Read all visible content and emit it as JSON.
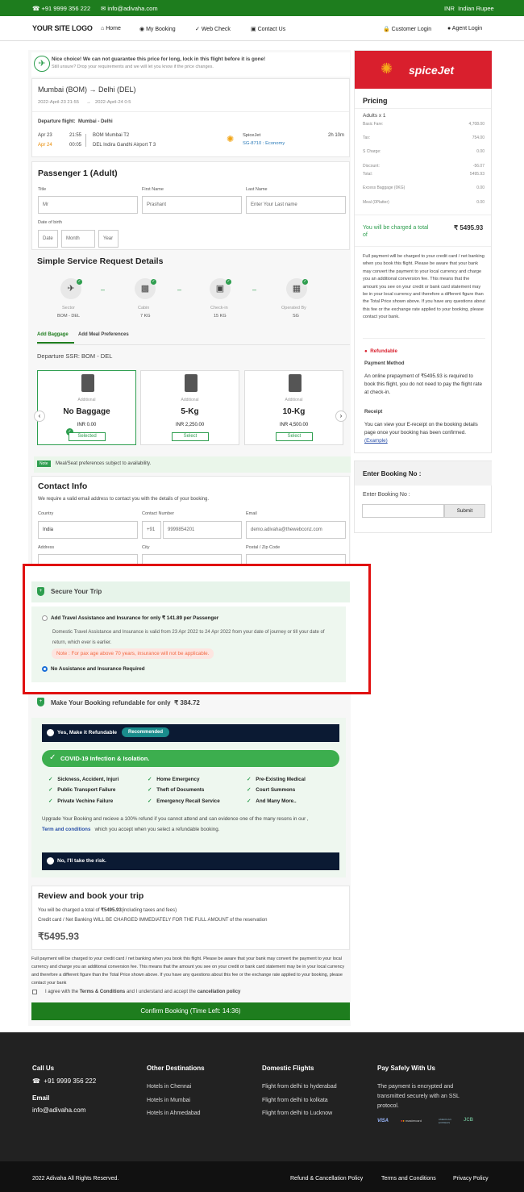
{
  "topbar": {
    "phone": "+91 9999 356 222",
    "email": "info@adivaha.com",
    "currency_code": "INR",
    "currency_name": "Indian Rupee"
  },
  "nav": {
    "logo": "YOUR SITE LOGO",
    "home": "Home",
    "my_booking": "My Booking",
    "web_check": "Web Check",
    "contact": "Contact Us",
    "customer_login": "Customer Login",
    "agent_login": "Agent Login"
  },
  "notice": {
    "title": "Nice choice! We can not guarantee this price for long, lock in this flight before it is gone!",
    "sub": "Still unsure? Drop your requirements and we will let you know if the price changes."
  },
  "flight": {
    "route": "Mumbai (BOM) → Delhi (DEL)",
    "dep_time": "2022-April-23 21:55",
    "arrow": "→",
    "arr_time": "2022-April-24 0:5",
    "dep_label": "Departure flight:",
    "dep_route": "Mumbai  -  Delhi",
    "dep_date": "Apr 23",
    "arr_date": "Apr 24",
    "dep_clock": "21:55",
    "arr_clock": "00:05",
    "dep_airport": "BOM Mumbai T2",
    "arr_airport": "DEL Indira Gandhi Airport T 3",
    "airline": "SpiceJet",
    "flight_no": "SG-8710 :",
    "cabin": "Economy",
    "duration": "2h 10m"
  },
  "passenger": {
    "heading": "Passenger 1 (Adult)",
    "title_label": "Title",
    "title_value": "Mr",
    "first_label": "First Name",
    "first_value": "Prashant",
    "last_label": "Last Name",
    "last_placeholder": "Enter Your Last name",
    "dob_label": "Date of birth",
    "date": "Date",
    "month": "Month",
    "year": "Year"
  },
  "service": {
    "heading": "Simple Service Request Details",
    "items": [
      {
        "label": "Sector",
        "value": "BOM - DEL"
      },
      {
        "label": "Cabin",
        "value": "7 KG"
      },
      {
        "label": "Check-in",
        "value": "15 KG"
      },
      {
        "label": "Operated By",
        "value": "SG"
      }
    ],
    "tab_baggage": "Add Baggage",
    "tab_meal": "Add Meal Preferences",
    "ssr": "Departure SSR: BOM - DEL",
    "bags": [
      {
        "add": "Additional",
        "title": "No Baggage",
        "price": "INR 0.00",
        "btn": "Selected"
      },
      {
        "add": "Additional",
        "title": "5-Kg",
        "price": "INR 2,250.00",
        "btn": "Select"
      },
      {
        "add": "Additional",
        "title": "10-Kg",
        "price": "INR 4,500.00",
        "btn": "Select"
      }
    ],
    "note_tag": "Note",
    "note": "Meal/Seat preferences subject to availability."
  },
  "contact": {
    "heading": "Contact Info",
    "sub": "We require a valid email address to contact you with the details of your booking.",
    "country_label": "Country",
    "country_value": "India",
    "phone_label": "Contact Number",
    "phone_code": "+91",
    "phone_value": "9999854201",
    "email_label": "Email",
    "email_value": "demo.adivaha@thewebconz.com",
    "address_label": "Address",
    "city_label": "City",
    "zip_label": "Postal / Zip Code"
  },
  "secure": {
    "heading": "Secure Your Trip",
    "opt1": "Add Travel Assistance and Insurance for only ₹ 141.89 per Passenger",
    "desc": "Domestic Travel Assistance and Insurance is valid from 23 Apr 2022 to 24 Apr 2022 from your date of journey or till your date of return, which ever is earlier.",
    "warn": "Note : For pax age above 70 years, insurance will not be applicable.",
    "opt2": "No Assistance and Insurance Required"
  },
  "refund": {
    "heading": "Make Your Booking refundable for only",
    "amount": "₹ 384.72",
    "yes": "Yes, Make it Refundable",
    "recommended": "Recommended",
    "covid": "COVID-19 Infection & Isolation.",
    "items": [
      "Sickness, Accident, Injuri",
      "Home Emergency",
      "Pre-Existing Medical",
      "Public Transport Failure",
      "Theft of Documents",
      "Court Summons",
      "Private Vechine Failure",
      "Emergency Recall Service",
      "And Many More.."
    ],
    "upgrade": "Upgrade Your Booking and recieve a 100% refund if you cannot attend and can evidence one of the many resons in our ,",
    "terms": "Term and conditions",
    "upgrade2": "which you accept when you select a refundable booking.",
    "no": "No, I'll take the risk."
  },
  "review": {
    "heading": "Review and book your trip",
    "charged": "You will be charged a total of",
    "total_bold": "₹5495.93",
    "charged_suffix": "(including taxes and fees)",
    "credit": "Credit card / Net Banking WILL BE CHARGED IMMEDIATELY FOR THE FULL AMOUNT of the reservation",
    "total": "₹5495.93",
    "disclaimer": "Full payment will be charged to your credit card / net banking when you book this flight. Please be aware that your bank may convert the payment to your local currency and charge you an additional conversion fee. This means that the amount you see on your credit or bank card statement may be in your local currency and therefore a different figure than the Total Price shown above. If you have any questions about this fee or the exchange rate applied to your booking, please contact your bank",
    "agree_pre": "I agree with the",
    "agree_terms": "Terms & Conditions",
    "agree_mid": "and I understand and accept the",
    "agree_policy": "cancellation policy",
    "confirm": "Confirm Booking (Time Left: 14:36)"
  },
  "sidebar": {
    "brand": "spiceJet",
    "pricing": "Pricing",
    "adults": "Adults x 1",
    "rows": [
      {
        "label": "Basic Fare:",
        "value": "4,708.00"
      },
      {
        "label": "Tax:",
        "value": "754.00"
      },
      {
        "label": "S Charge:",
        "value": "0.00"
      },
      {
        "label": "Discount:",
        "value": "-56.07"
      },
      {
        "label": "Total:",
        "value": "5495.93"
      },
      {
        "label": "Excess Baggage (0KG)",
        "value": "0.00"
      },
      {
        "label": "Meal (0Platter)",
        "value": "0.00"
      }
    ],
    "charged": "You will be charged a total of",
    "charged_amount": "₹ 5495.93",
    "full_payment": "Full payment will be charged to your credit card / net banking when you book this flight. Please be aware that your bank may convert the payment to your local currency and charge you an additional conversion fee. This means that the amount you see on your credit or bank card statement may be in your local currency and therefore a different figure than the Total Price shown above. If you have any questions about this fee or the exchange rate applied to your booking, please contact your bank.",
    "refundable": "Refundable",
    "payment_method": "Payment Method",
    "payment_text": "An online prepayment of ₹5495.93 is required to book this flight, you do not need to pay the flight rate at check-in.",
    "receipt": "Receipt",
    "receipt_text": "You can view your E-receipt on the booking details page once your booking has been confirmed.",
    "example": "(Example)",
    "booking_heading": "Enter Booking No :",
    "booking_label": "Enter Booking No :",
    "submit": "Submit"
  },
  "footer": {
    "call_us": "Call Us",
    "phone": "+91 9999 356 222",
    "email_h": "Email",
    "email": "info@adivaha.com",
    "other_h": "Other Destinations",
    "other": [
      "Hotels in Chennai",
      "Hotels in Mumbai",
      "Hotels in Ahmedabad"
    ],
    "domestic_h": "Domestic Flights",
    "domestic": [
      "Flight from delhi to hyderabad",
      "Flight from delhi to kolkata",
      "Flight from delhi to Lucknow"
    ],
    "pay_h": "Pay Safely With Us",
    "pay": "The payment is encrypted and transmitted securely with an SSL protocol.",
    "cards": [
      "VISA",
      "mastercard",
      "AMERICAN EXPRESS",
      "JCB"
    ],
    "copyright": "2022 Adivaha All Rights Reserved.",
    "links": [
      "Refund & Cancellation Policy",
      "Terms and Conditions",
      "Privacy Policy"
    ]
  },
  "colors": {
    "brand_green": "#1e7d1e",
    "accent_green": "#2e9e4f",
    "spicejet_red": "#d91f2d",
    "highlight_red": "#e01010",
    "dark_navy": "#0b1a33"
  }
}
